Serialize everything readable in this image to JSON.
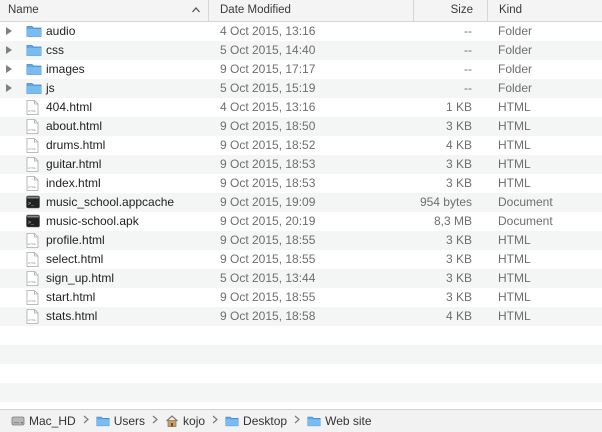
{
  "header": {
    "name": "Name",
    "date": "Date Modified",
    "size": "Size",
    "kind": "Kind"
  },
  "rows": [
    {
      "name": "audio",
      "date": "4 Oct 2015, 13:16",
      "size": "--",
      "kind": "Folder",
      "icon": "folder-icon"
    },
    {
      "name": "css",
      "date": "5 Oct 2015, 14:40",
      "size": "--",
      "kind": "Folder",
      "icon": "folder-icon"
    },
    {
      "name": "images",
      "date": "9 Oct 2015, 17:17",
      "size": "--",
      "kind": "Folder",
      "icon": "folder-icon"
    },
    {
      "name": "js",
      "date": "5 Oct 2015, 15:19",
      "size": "--",
      "kind": "Folder",
      "icon": "folder-icon"
    },
    {
      "name": "404.html",
      "date": "4 Oct 2015, 13:16",
      "size": "1 KB",
      "kind": "HTML",
      "icon": "html-file-icon"
    },
    {
      "name": "about.html",
      "date": "9 Oct 2015, 18:50",
      "size": "3 KB",
      "kind": "HTML",
      "icon": "html-file-icon"
    },
    {
      "name": "drums.html",
      "date": "9 Oct 2015, 18:52",
      "size": "4 KB",
      "kind": "HTML",
      "icon": "html-file-icon"
    },
    {
      "name": "guitar.html",
      "date": "9 Oct 2015, 18:53",
      "size": "3 KB",
      "kind": "HTML",
      "icon": "html-file-icon"
    },
    {
      "name": "index.html",
      "date": "9 Oct 2015, 18:53",
      "size": "3 KB",
      "kind": "HTML",
      "icon": "html-file-icon"
    },
    {
      "name": "music_school.appcache",
      "date": "9 Oct 2015, 19:09",
      "size": "954 bytes",
      "kind": "Document",
      "icon": "terminal-document-icon"
    },
    {
      "name": "music-school.apk",
      "date": "9 Oct 2015, 20:19",
      "size": "8,3 MB",
      "kind": "Document",
      "icon": "terminal-document-icon"
    },
    {
      "name": "profile.html",
      "date": "9 Oct 2015, 18:55",
      "size": "3 KB",
      "kind": "HTML",
      "icon": "html-file-icon"
    },
    {
      "name": "select.html",
      "date": "9 Oct 2015, 18:55",
      "size": "3 KB",
      "kind": "HTML",
      "icon": "html-file-icon"
    },
    {
      "name": "sign_up.html",
      "date": "5 Oct 2015, 13:44",
      "size": "3 KB",
      "kind": "HTML",
      "icon": "html-file-icon"
    },
    {
      "name": "start.html",
      "date": "9 Oct 2015, 18:55",
      "size": "3 KB",
      "kind": "HTML",
      "icon": "html-file-icon"
    },
    {
      "name": "stats.html",
      "date": "9 Oct 2015, 18:58",
      "size": "4 KB",
      "kind": "HTML",
      "icon": "html-file-icon"
    }
  ],
  "path": [
    {
      "label": "Mac_HD",
      "icon": "hard-drive-icon"
    },
    {
      "label": "Users",
      "icon": "folder-icon"
    },
    {
      "label": "kojo",
      "icon": "home-icon"
    },
    {
      "label": "Desktop",
      "icon": "folder-icon"
    },
    {
      "label": "Web site",
      "icon": "folder-icon"
    }
  ],
  "colors": {
    "folder": "#5fa8e8",
    "alt_row": "#f4f5f5",
    "meta_text": "#6e6e6e"
  }
}
